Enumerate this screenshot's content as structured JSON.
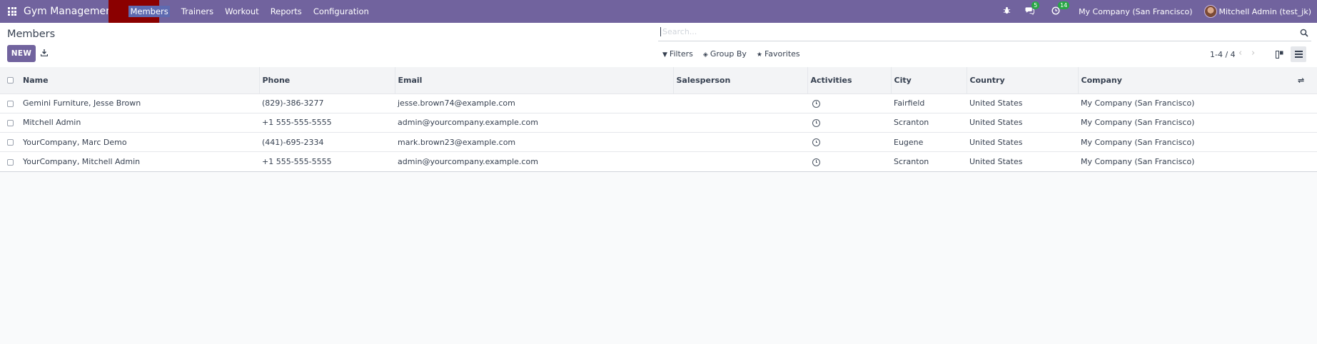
{
  "navbar": {
    "app_title": "Gym Management",
    "menu": [
      "Members",
      "Trainers",
      "Workout",
      "Reports",
      "Configuration"
    ],
    "messages_badge": "5",
    "activities_badge": "14",
    "company": "My Company (San Francisco)",
    "user": "Mitchell Admin (test_jk)"
  },
  "control_panel": {
    "breadcrumb": "Members",
    "new_button": "NEW",
    "search_placeholder": "Search...",
    "filters": "Filters",
    "group_by": "Group By",
    "favorites": "Favorites",
    "pager": "1-4 / 4"
  },
  "table": {
    "columns": [
      "Name",
      "Phone",
      "Email",
      "Salesperson",
      "Activities",
      "City",
      "Country",
      "Company"
    ],
    "rows": [
      {
        "name": "Gemini Furniture, Jesse Brown",
        "phone": "(829)-386-3277",
        "email": "jesse.brown74@example.com",
        "salesperson": "",
        "city": "Fairfield",
        "country": "United States",
        "company": "My Company (San Francisco)"
      },
      {
        "name": "Mitchell Admin",
        "phone": "+1 555-555-5555",
        "email": "admin@yourcompany.example.com",
        "salesperson": "",
        "city": "Scranton",
        "country": "United States",
        "company": "My Company (San Francisco)"
      },
      {
        "name": "YourCompany, Marc Demo",
        "phone": "(441)-695-2334",
        "email": "mark.brown23@example.com",
        "salesperson": "",
        "city": "Eugene",
        "country": "United States",
        "company": "My Company (San Francisco)"
      },
      {
        "name": "YourCompany, Mitchell Admin",
        "phone": "+1 555-555-5555",
        "email": "admin@yourcompany.example.com",
        "salesperson": "",
        "city": "Scranton",
        "country": "United States",
        "company": "My Company (San Francisco)"
      }
    ]
  },
  "colors": {
    "navbar": "#71639e",
    "highlight": "#8b0000",
    "badge": "#28a745"
  }
}
